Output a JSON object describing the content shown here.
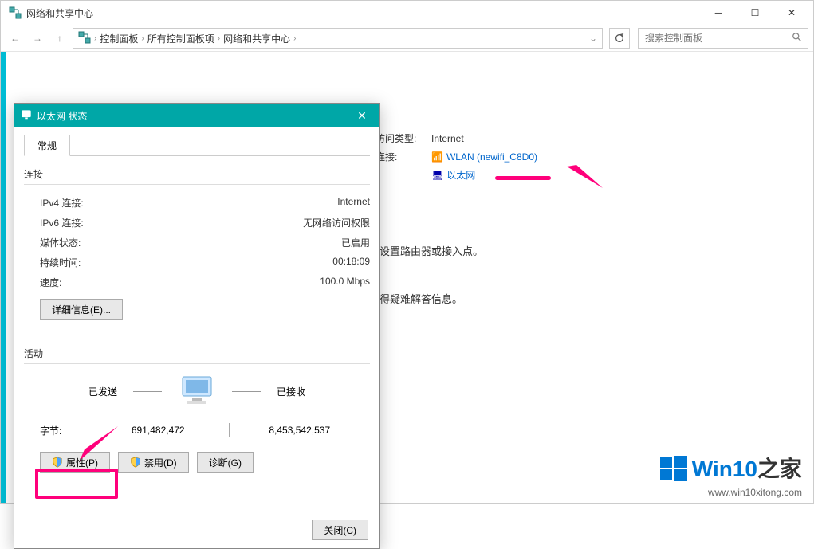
{
  "main": {
    "title": "网络和共享中心",
    "breadcrumb": [
      "控制面板",
      "所有控制面板项",
      "网络和共享中心"
    ],
    "search_placeholder": "搜索控制面板"
  },
  "right_panel": {
    "access_label": "访问类型:",
    "access_value": "Internet",
    "connections_label": "连接:",
    "wlan": "WLAN (newifi_C8D0)",
    "ethernet": "以太网"
  },
  "mid_texts": {
    "line1": "或设置路由器或接入点。",
    "line2": "获得疑难解答信息。"
  },
  "dlg": {
    "title": "以太网 状态",
    "tab": "常规",
    "group_conn": "连接",
    "ipv4_label": "IPv4 连接:",
    "ipv4_value": "Internet",
    "ipv6_label": "IPv6 连接:",
    "ipv6_value": "无网络访问权限",
    "media_label": "媒体状态:",
    "media_value": "已启用",
    "duration_label": "持续时间:",
    "duration_value": "00:18:09",
    "speed_label": "速度:",
    "speed_value": "100.0 Mbps",
    "details_btn": "详细信息(E)...",
    "group_activity": "活动",
    "sent_label": "已发送",
    "recv_label": "已接收",
    "bytes_label": "字节:",
    "bytes_sent": "691,482,472",
    "bytes_recv": "8,453,542,537",
    "btn_props": "属性(P)",
    "btn_disable": "禁用(D)",
    "btn_diag": "诊断(G)",
    "btn_close": "关闭(C)"
  },
  "watermark": {
    "text": "Win10之家",
    "sub": "www.win10xitong.com"
  }
}
